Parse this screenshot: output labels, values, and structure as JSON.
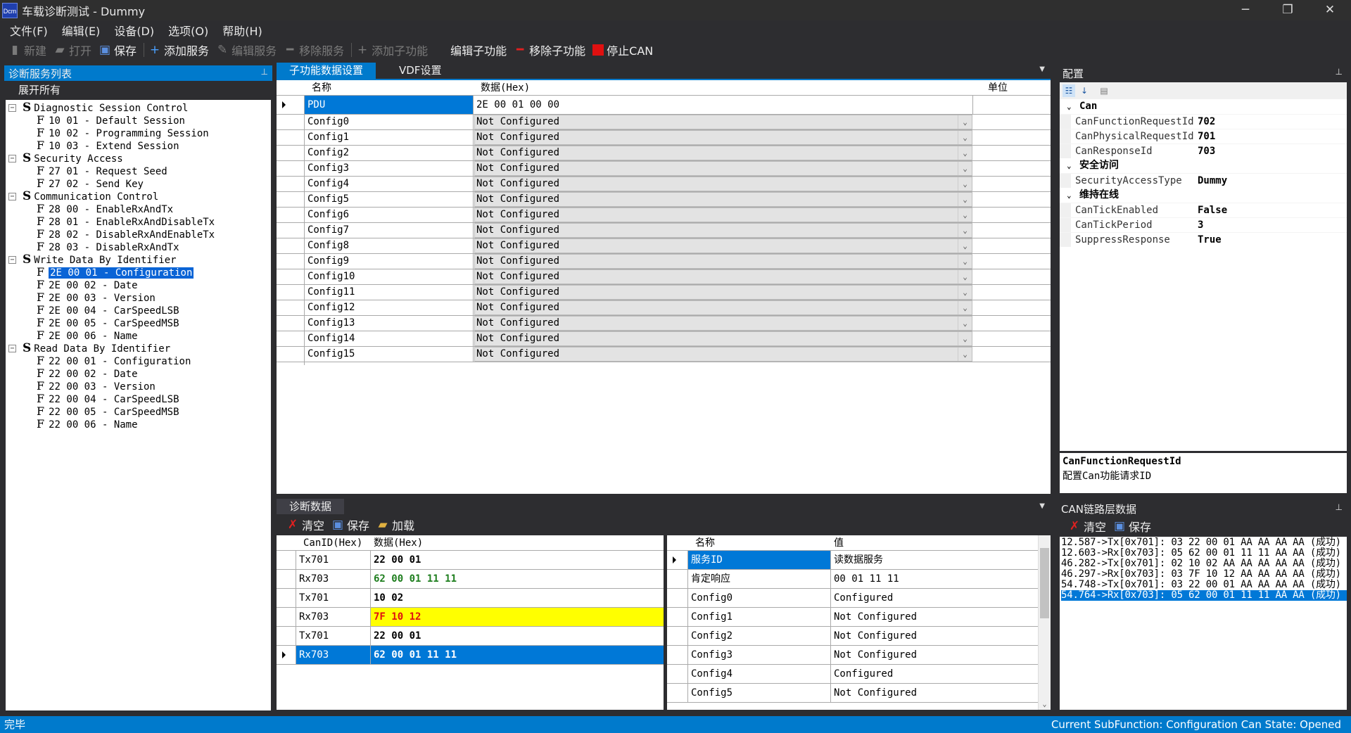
{
  "window": {
    "icon_text": "Dcm",
    "title": "车载诊断测试 - Dummy",
    "min": "─",
    "max": "❐",
    "close": "✕"
  },
  "menu": [
    "文件(F)",
    "编辑(E)",
    "设备(D)",
    "选项(O)",
    "帮助(H)"
  ],
  "toolbar": {
    "new": "新建",
    "open": "打开",
    "save": "保存",
    "add_service": "添加服务",
    "edit_service": "编辑服务",
    "remove_service": "移除服务",
    "add_sub": "添加子功能",
    "edit_sub": "编辑子功能",
    "remove_sub": "移除子功能",
    "stop_can": "停止CAN"
  },
  "left": {
    "title": "诊断服务列表",
    "expand_all": "展开所有",
    "tree": [
      {
        "type": "S",
        "label": "Diagnostic Session Control",
        "children": [
          "10 01 - Default Session",
          "10 02 - Programming Session",
          "10 03 - Extend Session"
        ]
      },
      {
        "type": "S",
        "label": "Security Access",
        "children": [
          "27 01 - Request Seed",
          "27 02 - Send Key"
        ]
      },
      {
        "type": "S",
        "label": "Communication Control",
        "children": [
          "28 00 - EnableRxAndTx",
          "28 01 - EnableRxAndDisableTx",
          "28 02 - DisableRxAndEnableTx",
          "28 03 - DisableRxAndTx"
        ]
      },
      {
        "type": "S",
        "label": "Write Data By Identifier",
        "children": [
          "2E 00 01 - Configuration",
          "2E 00 02 - Date",
          "2E 00 03 - Version",
          "2E 00 04 - CarSpeedLSB",
          "2E 00 05 - CarSpeedMSB",
          "2E 00 06 - Name"
        ]
      },
      {
        "type": "S",
        "label": "Read Data By Identifier",
        "children": [
          "22 00 01 - Configuration",
          "22 00 02 - Date",
          "22 00 03 - Version",
          "22 00 04 - CarSpeedLSB",
          "22 00 05 - CarSpeedMSB",
          "22 00 06 - Name"
        ]
      }
    ],
    "selected": "2E 00 01 - Configuration"
  },
  "tabs": {
    "sub": "子功能数据设置",
    "vdf": "VDF设置"
  },
  "grid1": {
    "headers": {
      "name": "名称",
      "data": "数据(Hex)",
      "unit": "单位"
    },
    "pdu": {
      "name": "PDU",
      "data": "2E 00 01 00 00"
    },
    "rows": [
      {
        "name": "Config0",
        "value": "Not Configured"
      },
      {
        "name": "Config1",
        "value": "Not Configured"
      },
      {
        "name": "Config2",
        "value": "Not Configured"
      },
      {
        "name": "Config3",
        "value": "Not Configured"
      },
      {
        "name": "Config4",
        "value": "Not Configured"
      },
      {
        "name": "Config5",
        "value": "Not Configured"
      },
      {
        "name": "Config6",
        "value": "Not Configured"
      },
      {
        "name": "Config7",
        "value": "Not Configured"
      },
      {
        "name": "Config8",
        "value": "Not Configured"
      },
      {
        "name": "Config9",
        "value": "Not Configured"
      },
      {
        "name": "Config10",
        "value": "Not Configured"
      },
      {
        "name": "Config11",
        "value": "Not Configured"
      },
      {
        "name": "Config12",
        "value": "Not Configured"
      },
      {
        "name": "Config13",
        "value": "Not Configured"
      },
      {
        "name": "Config14",
        "value": "Not Configured"
      },
      {
        "name": "Config15",
        "value": "Not Configured"
      }
    ]
  },
  "config": {
    "title": "配置",
    "categories": [
      {
        "name": "Can",
        "props": [
          {
            "k": "CanFunctionRequestId",
            "v": "702"
          },
          {
            "k": "CanPhysicalRequestId",
            "v": "701"
          },
          {
            "k": "CanResponseId",
            "v": "703"
          }
        ]
      },
      {
        "name": "安全访问",
        "props": [
          {
            "k": "SecurityAccessType",
            "v": "Dummy"
          }
        ]
      },
      {
        "name": "维持在线",
        "props": [
          {
            "k": "CanTickEnabled",
            "v": "False"
          },
          {
            "k": "CanTickPeriod",
            "v": "3"
          },
          {
            "k": "SuppressResponse",
            "v": "True"
          }
        ]
      }
    ],
    "desc_title": "CanFunctionRequestId",
    "desc_text": "配置Can功能请求ID"
  },
  "diag": {
    "title": "诊断数据",
    "clear": "清空",
    "save": "保存",
    "load": "加载",
    "headers": {
      "canid": "CanID(Hex)",
      "data": "数据(Hex)"
    },
    "rows": [
      {
        "id": "Tx701",
        "data": "22 00 01",
        "color": "#000000",
        "bg": "#ffffff"
      },
      {
        "id": "Rx703",
        "data": "62 00 01 11 11",
        "color": "#1e7e1e",
        "bg": "#ffffff"
      },
      {
        "id": "Tx701",
        "data": "10 02",
        "color": "#000000",
        "bg": "#ffffff"
      },
      {
        "id": "Rx703",
        "data": "7F 10 12",
        "color": "#e01010",
        "bg": "#ffff00"
      },
      {
        "id": "Tx701",
        "data": "22 00 01",
        "color": "#000000",
        "bg": "#ffffff"
      },
      {
        "id": "Rx703",
        "data": "62 00 01 11 11",
        "color": "#ffffff",
        "bg": "#0078d7"
      }
    ],
    "detail_headers": {
      "name": "名称",
      "value": "值"
    },
    "detail": [
      {
        "name": "服务ID",
        "value": "读数据服务"
      },
      {
        "name": "肯定响应",
        "value": "00 01 11 11"
      },
      {
        "name": "Config0",
        "value": "Configured"
      },
      {
        "name": "Config1",
        "value": "Not Configured"
      },
      {
        "name": "Config2",
        "value": "Not Configured"
      },
      {
        "name": "Config3",
        "value": "Not Configured"
      },
      {
        "name": "Config4",
        "value": "Configured"
      },
      {
        "name": "Config5",
        "value": "Not Configured"
      }
    ]
  },
  "can": {
    "title": "CAN链路层数据",
    "clear": "清空",
    "save": "保存",
    "lines": [
      "12.587->Tx[0x701]: 03 22 00 01 AA AA AA AA (成功)",
      "12.603->Rx[0x703]: 05 62 00 01 11 11 AA AA (成功)",
      "46.282->Tx[0x701]: 02 10 02 AA AA AA AA AA (成功)",
      "46.297->Rx[0x703]: 03 7F 10 12 AA AA AA AA (成功)",
      "54.748->Tx[0x701]: 03 22 00 01 AA AA AA AA (成功)",
      "54.764->Rx[0x703]: 05 62 00 01 11 11 AA AA (成功)"
    ]
  },
  "status": {
    "left": "完毕",
    "right": "Current SubFunction: Configuration  Can State: Opened"
  }
}
